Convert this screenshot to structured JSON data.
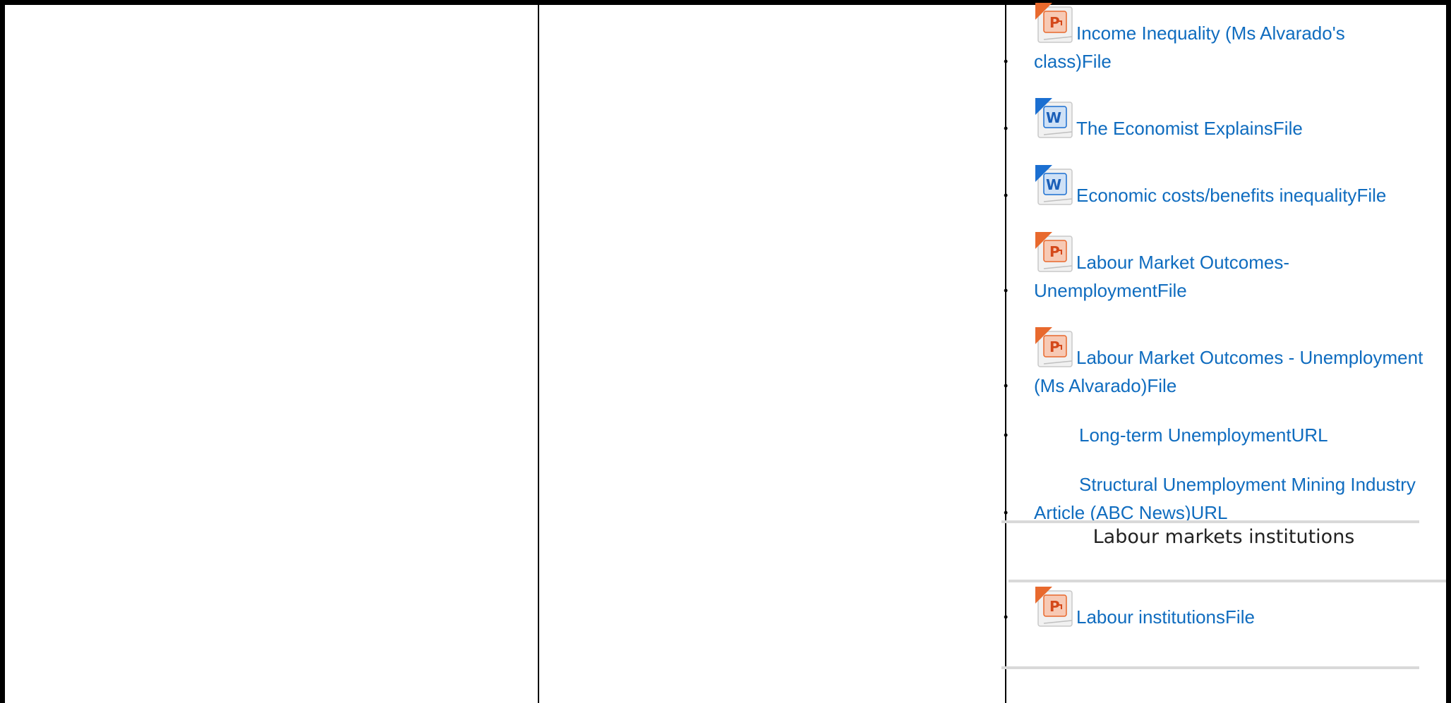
{
  "resources": [
    {
      "title": "Income Inequality (Ms Alvarado's class)",
      "type_label": "File",
      "icon": "powerpoint-file-icon"
    },
    {
      "title": "The Economist Explains",
      "type_label": "File",
      "icon": "word-file-icon"
    },
    {
      "title": "Economic costs/benefits inequality",
      "type_label": "File",
      "icon": "word-file-icon"
    },
    {
      "title": "Labour Market Outcomes- Unemployment",
      "type_label": "File",
      "icon": "powerpoint-file-icon"
    },
    {
      "title": "Labour Market Outcomes - Unemployment (Ms Alvarado)",
      "type_label": "File",
      "icon": "powerpoint-file-icon"
    },
    {
      "title": "Long-term Unemployment",
      "type_label": "URL",
      "icon": "url-link-icon"
    },
    {
      "title": "Structural Unemployment Mining Industry Article (ABC News)",
      "type_label": "URL",
      "icon": "url-link-icon"
    }
  ],
  "section": {
    "heading": "Labour markets institutions",
    "resources": [
      {
        "title": "Labour institutions",
        "type_label": "File",
        "icon": "powerpoint-file-icon"
      }
    ]
  },
  "colors": {
    "link": "#0f6cbf",
    "border": "#000000",
    "divider": "#d9d9d9",
    "ppt_accent": "#e8692d",
    "word_accent": "#1b6fd1"
  }
}
